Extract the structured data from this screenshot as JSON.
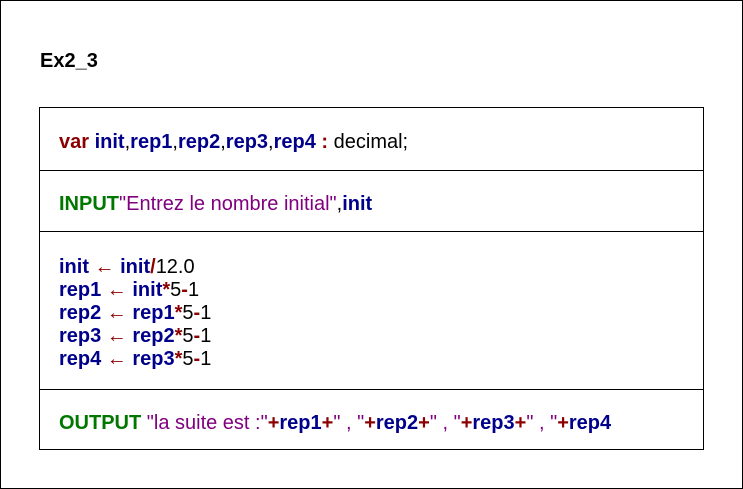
{
  "title": "Ex2_3",
  "declaration": {
    "keyword": "var",
    "v1": "init",
    "c1": ",",
    "v2": "rep1",
    "c2": ",",
    "v3": "rep2",
    "c3": ",",
    "v4": "rep3",
    "c4": ",",
    "v5": "rep4",
    "colon": " : ",
    "type": "decimal;"
  },
  "input": {
    "keyword": "INPUT",
    "prompt": "\"Entrez le nombre initial\"",
    "comma": ",",
    "variable": "init"
  },
  "assignments": [
    {
      "target": "init",
      "arrow": " ← ",
      "source": "init",
      "op1": "/",
      "num1": "12.0",
      "op2": "",
      "num2": ""
    },
    {
      "target": "rep1",
      "arrow": " ← ",
      "source": "init",
      "op1": "*",
      "num1": "5",
      "op2": "-",
      "num2": "1"
    },
    {
      "target": "rep2",
      "arrow": " ← ",
      "source": "rep1",
      "op1": "*",
      "num1": "5",
      "op2": "-",
      "num2": "1"
    },
    {
      "target": "rep3",
      "arrow": " ← ",
      "source": "rep2",
      "op1": "*",
      "num1": "5",
      "op2": "-",
      "num2": "1"
    },
    {
      "target": "rep4",
      "arrow": " ← ",
      "source": "rep3",
      "op1": "*",
      "num1": "5",
      "op2": "-",
      "num2": "1"
    }
  ],
  "output": {
    "keyword": "OUTPUT",
    "s1": " \"la suite est :\"",
    "p1": "+",
    "v1": "rep1",
    "p2": "+",
    "s2": "\" , \"",
    "p3": "+",
    "v2": "rep2",
    "p4": "+",
    "s3": "\" , \"",
    "p5": "+",
    "v3": "rep3",
    "p6": "+",
    "s4": "\" , \"",
    "p7": "+",
    "v4": "rep4"
  },
  "colors": {
    "keyword_red": "#8b0000",
    "keyword_green": "#007800",
    "variable_blue": "#00008b",
    "string_purple": "#800080"
  }
}
